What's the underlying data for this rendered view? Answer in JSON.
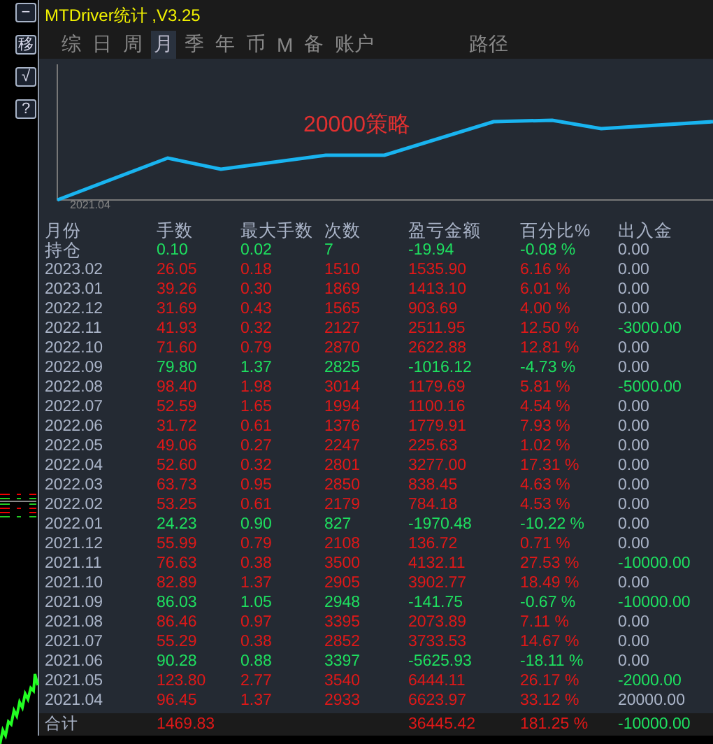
{
  "side_buttons": [
    {
      "label": "−"
    },
    {
      "label": "移"
    },
    {
      "label": "√"
    },
    {
      "label": "?"
    }
  ],
  "window": {
    "title": "MTDriver统计 ,V3.25"
  },
  "tabs": [
    {
      "label": "综",
      "selected": false
    },
    {
      "label": "日",
      "selected": false
    },
    {
      "label": "周",
      "selected": false
    },
    {
      "label": "月",
      "selected": true
    },
    {
      "label": "季",
      "selected": false
    },
    {
      "label": "年",
      "selected": false
    },
    {
      "label": "币",
      "selected": false
    },
    {
      "label": "M",
      "selected": false
    },
    {
      "label": "备",
      "selected": false
    },
    {
      "label": "账户",
      "selected": false
    },
    {
      "label": "路径",
      "selected": false
    }
  ],
  "chart": {
    "title": "20000策略",
    "start_label": "2021.04"
  },
  "table": {
    "columns": [
      "月份",
      "手数",
      "最大手数",
      "次数",
      "盈亏金额",
      "百分比%",
      "出入金"
    ],
    "rows": [
      {
        "month": "持仓",
        "lots": "0.10",
        "max_lots": "0.02",
        "trades": "7",
        "pnl": "-19.94",
        "pct": "-0.08 %",
        "deposit": "0.00",
        "kind": "loss",
        "withdrawal": false
      },
      {
        "month": "2023.02",
        "lots": "26.05",
        "max_lots": "0.18",
        "trades": "1510",
        "pnl": "1535.90",
        "pct": "6.16 %",
        "deposit": "0.00",
        "kind": "profit",
        "withdrawal": false
      },
      {
        "month": "2023.01",
        "lots": "39.26",
        "max_lots": "0.30",
        "trades": "1869",
        "pnl": "1413.10",
        "pct": "6.01 %",
        "deposit": "0.00",
        "kind": "profit",
        "withdrawal": false
      },
      {
        "month": "2022.12",
        "lots": "31.69",
        "max_lots": "0.43",
        "trades": "1565",
        "pnl": "903.69",
        "pct": "4.00 %",
        "deposit": "0.00",
        "kind": "profit",
        "withdrawal": false
      },
      {
        "month": "2022.11",
        "lots": "41.93",
        "max_lots": "0.32",
        "trades": "2127",
        "pnl": "2511.95",
        "pct": "12.50 %",
        "deposit": "-3000.00",
        "kind": "profit",
        "withdrawal": true
      },
      {
        "month": "2022.10",
        "lots": "71.60",
        "max_lots": "0.79",
        "trades": "2870",
        "pnl": "2622.88",
        "pct": "12.81 %",
        "deposit": "0.00",
        "kind": "profit",
        "withdrawal": false
      },
      {
        "month": "2022.09",
        "lots": "79.80",
        "max_lots": "1.37",
        "trades": "2825",
        "pnl": "-1016.12",
        "pct": "-4.73 %",
        "deposit": "0.00",
        "kind": "loss",
        "withdrawal": false
      },
      {
        "month": "2022.08",
        "lots": "98.40",
        "max_lots": "1.98",
        "trades": "3014",
        "pnl": "1179.69",
        "pct": "5.81 %",
        "deposit": "-5000.00",
        "kind": "profit",
        "withdrawal": true
      },
      {
        "month": "2022.07",
        "lots": "52.59",
        "max_lots": "1.65",
        "trades": "1994",
        "pnl": "1100.16",
        "pct": "4.54 %",
        "deposit": "0.00",
        "kind": "profit",
        "withdrawal": false
      },
      {
        "month": "2022.06",
        "lots": "31.72",
        "max_lots": "0.61",
        "trades": "1376",
        "pnl": "1779.91",
        "pct": "7.93 %",
        "deposit": "0.00",
        "kind": "profit",
        "withdrawal": false
      },
      {
        "month": "2022.05",
        "lots": "49.06",
        "max_lots": "0.27",
        "trades": "2247",
        "pnl": "225.63",
        "pct": "1.02 %",
        "deposit": "0.00",
        "kind": "profit",
        "withdrawal": false
      },
      {
        "month": "2022.04",
        "lots": "52.60",
        "max_lots": "0.32",
        "trades": "2801",
        "pnl": "3277.00",
        "pct": "17.31 %",
        "deposit": "0.00",
        "kind": "profit",
        "withdrawal": false
      },
      {
        "month": "2022.03",
        "lots": "63.73",
        "max_lots": "0.95",
        "trades": "2850",
        "pnl": "838.45",
        "pct": "4.63 %",
        "deposit": "0.00",
        "kind": "profit",
        "withdrawal": false
      },
      {
        "month": "2022.02",
        "lots": "53.25",
        "max_lots": "0.61",
        "trades": "2179",
        "pnl": "784.18",
        "pct": "4.53 %",
        "deposit": "0.00",
        "kind": "profit",
        "withdrawal": false
      },
      {
        "month": "2022.01",
        "lots": "24.23",
        "max_lots": "0.90",
        "trades": "827",
        "pnl": "-1970.48",
        "pct": "-10.22 %",
        "deposit": "0.00",
        "kind": "loss",
        "withdrawal": false
      },
      {
        "month": "2021.12",
        "lots": "55.99",
        "max_lots": "0.79",
        "trades": "2108",
        "pnl": "136.72",
        "pct": "0.71 %",
        "deposit": "0.00",
        "kind": "profit",
        "withdrawal": false
      },
      {
        "month": "2021.11",
        "lots": "76.63",
        "max_lots": "0.38",
        "trades": "3500",
        "pnl": "4132.11",
        "pct": "27.53 %",
        "deposit": "-10000.00",
        "kind": "profit",
        "withdrawal": true
      },
      {
        "month": "2021.10",
        "lots": "82.89",
        "max_lots": "1.37",
        "trades": "2905",
        "pnl": "3902.77",
        "pct": "18.49 %",
        "deposit": "0.00",
        "kind": "profit",
        "withdrawal": false
      },
      {
        "month": "2021.09",
        "lots": "86.03",
        "max_lots": "1.05",
        "trades": "2948",
        "pnl": "-141.75",
        "pct": "-0.67 %",
        "deposit": "-10000.00",
        "kind": "loss",
        "withdrawal": true
      },
      {
        "month": "2021.08",
        "lots": "86.46",
        "max_lots": "0.97",
        "trades": "3395",
        "pnl": "2073.89",
        "pct": "7.11 %",
        "deposit": "0.00",
        "kind": "profit",
        "withdrawal": false
      },
      {
        "month": "2021.07",
        "lots": "55.29",
        "max_lots": "0.38",
        "trades": "2852",
        "pnl": "3733.53",
        "pct": "14.67 %",
        "deposit": "0.00",
        "kind": "profit",
        "withdrawal": false
      },
      {
        "month": "2021.06",
        "lots": "90.28",
        "max_lots": "0.88",
        "trades": "3397",
        "pnl": "-5625.93",
        "pct": "-18.11 %",
        "deposit": "0.00",
        "kind": "loss",
        "withdrawal": false
      },
      {
        "month": "2021.05",
        "lots": "123.80",
        "max_lots": "2.77",
        "trades": "3540",
        "pnl": "6444.11",
        "pct": "26.17 %",
        "deposit": "-2000.00",
        "kind": "profit",
        "withdrawal": true
      },
      {
        "month": "2021.04",
        "lots": "96.45",
        "max_lots": "1.37",
        "trades": "2933",
        "pnl": "6623.97",
        "pct": "33.12 %",
        "deposit": "20000.00",
        "kind": "profit",
        "withdrawal": false
      }
    ],
    "total": {
      "month": "合计",
      "lots": "1469.83",
      "pnl": "36445.42",
      "pct": "181.25 %",
      "deposit": "-10000.00",
      "kind": "profit",
      "withdrawal": true
    }
  }
}
